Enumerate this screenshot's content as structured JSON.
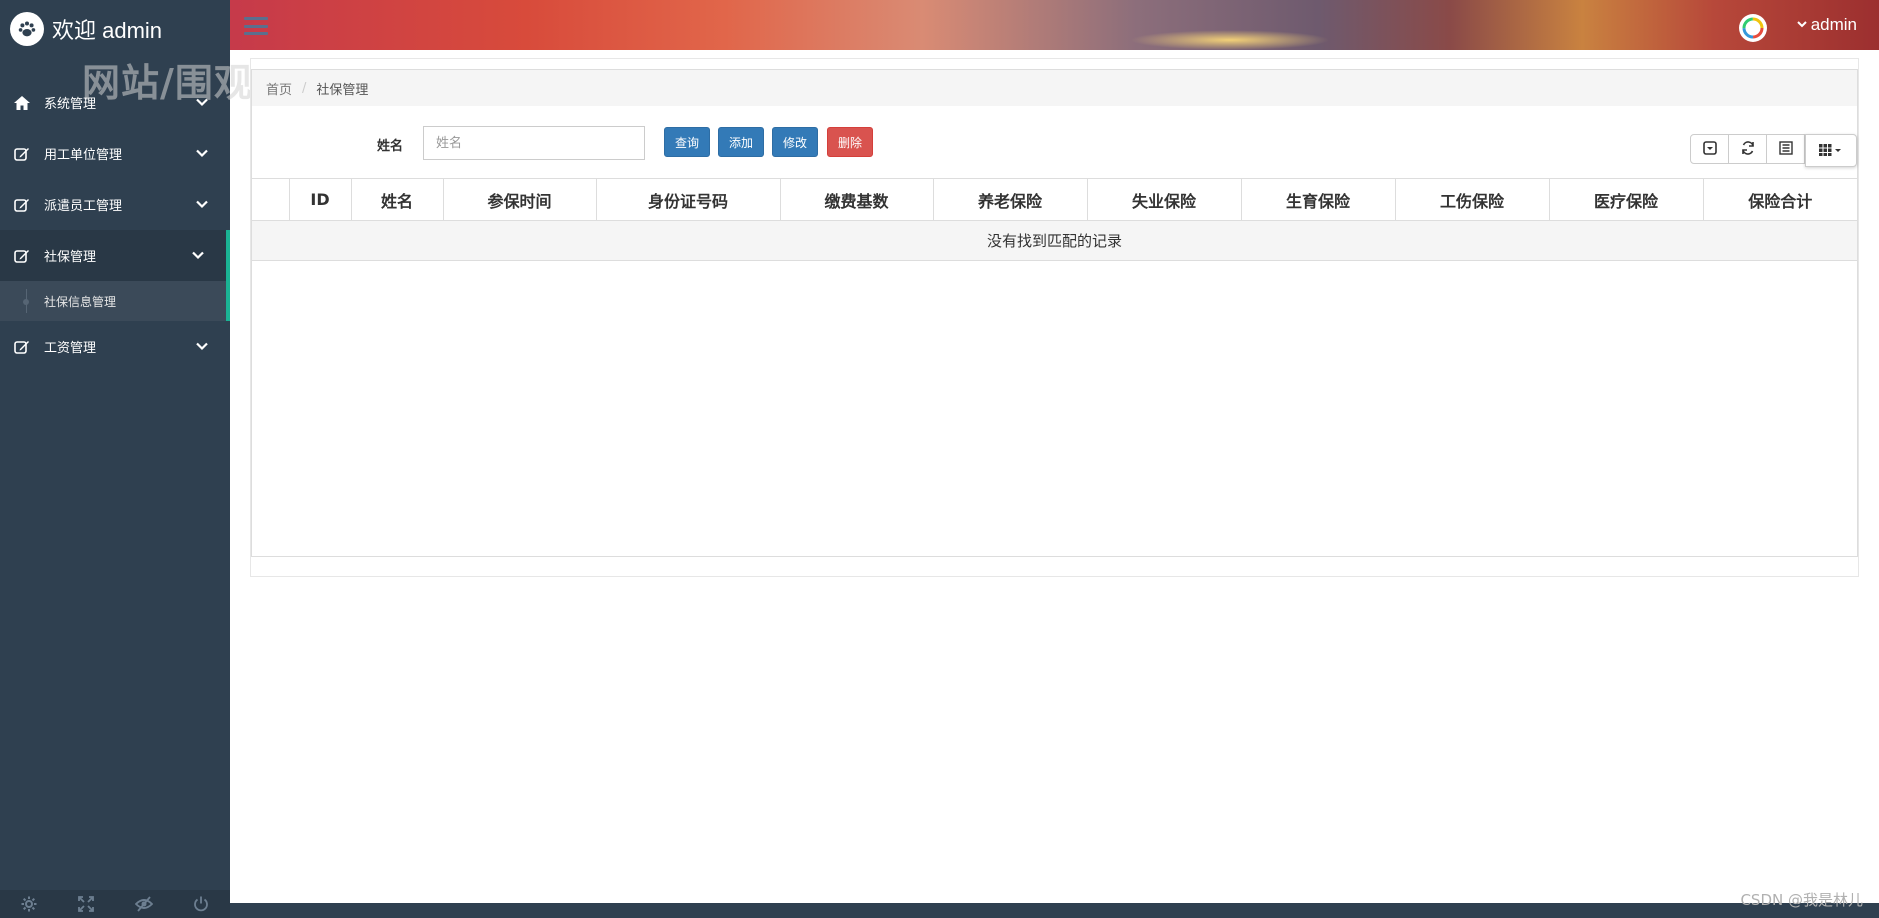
{
  "sidebar": {
    "brand_title": "欢迎 admin",
    "watermark": "网站/围观客",
    "items": [
      {
        "label": "系统管理",
        "icon": "home-icon"
      },
      {
        "label": "用工单位管理",
        "icon": "edit-icon"
      },
      {
        "label": "派遣员工管理",
        "icon": "edit-icon"
      },
      {
        "label": "社保管理",
        "icon": "edit-icon",
        "active": true
      },
      {
        "label": "工资管理",
        "icon": "edit-icon"
      }
    ],
    "sub_item": "社保信息管理",
    "footer_icons": [
      "settings-icon",
      "fullscreen-icon",
      "lock-icon",
      "power-icon"
    ]
  },
  "header": {
    "username": "admin"
  },
  "breadcrumb": {
    "home": "首页",
    "separator": "/",
    "current": "社保管理"
  },
  "filter": {
    "name_label": "姓名",
    "name_placeholder": "姓名"
  },
  "buttons": {
    "query": "查询",
    "add": "添加",
    "edit": "修改",
    "delete": "删除"
  },
  "table": {
    "columns": [
      "",
      "ID",
      "姓名",
      "参保时间",
      "身份证号码",
      "缴费基数",
      "养老保险",
      "失业保险",
      "生育保险",
      "工伤保险",
      "医疗保险",
      "保险合计"
    ],
    "empty_text": "没有找到匹配的记录"
  },
  "credit": "CSDN @我是林儿",
  "colors": {
    "sidebar_bg": "#2f4050",
    "accent_green": "#1ab394",
    "primary": "#337ab7",
    "danger": "#d9534f"
  }
}
